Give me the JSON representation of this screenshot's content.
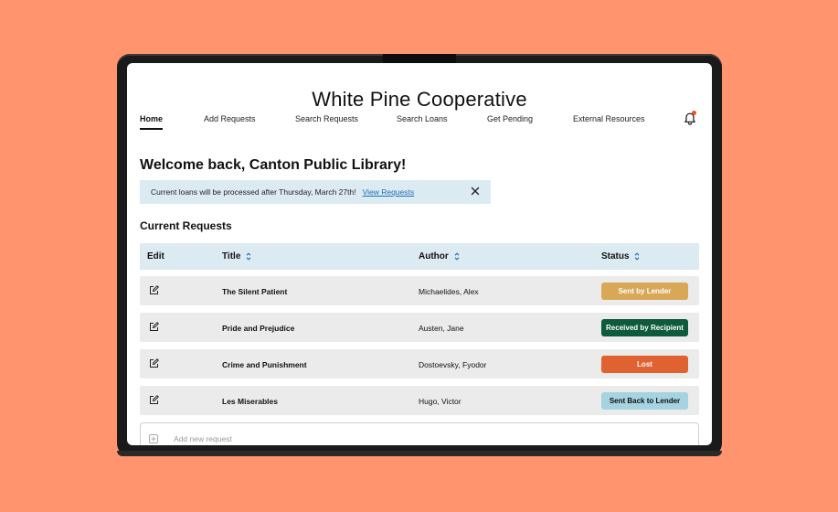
{
  "app": {
    "title": "White Pine Cooperative"
  },
  "nav": {
    "items": [
      {
        "label": "Home"
      },
      {
        "label": "Add Requests"
      },
      {
        "label": "Search Requests"
      },
      {
        "label": "Search Loans"
      },
      {
        "label": "Get Pending"
      },
      {
        "label": "External Resources"
      }
    ],
    "active": "Home"
  },
  "welcome": "Welcome back, Canton Public Library!",
  "banner": {
    "message": "Current loans will be processed after Thursday, March 27th!",
    "link": "View Requests"
  },
  "requests": {
    "heading": "Current Requests",
    "columns": {
      "edit": "Edit",
      "title": "Title",
      "author": "Author",
      "status": "Status"
    },
    "rows": [
      {
        "title": "The Silent Patient",
        "author": "Michaelides, Alex",
        "status": "Sent by Lender",
        "status_color": "#D9A857",
        "status_text_color": "#ffffff"
      },
      {
        "title": "Pride and Prejudice",
        "author": "Austen, Jane",
        "status": "Received by Recipient",
        "status_color": "#0E5A3C",
        "status_text_color": "#ffffff"
      },
      {
        "title": "Crime and Punishment",
        "author": "Dostoevsky, Fyodor",
        "status": "Lost",
        "status_color": "#E06230",
        "status_text_color": "#ffffff"
      },
      {
        "title": "Les Miserables",
        "author": "Hugo, Victor",
        "status": "Sent Back to Lender",
        "status_color": "#A5D3DF",
        "status_text_color": "#111111"
      }
    ],
    "add_label": "Add new request"
  },
  "colors": {
    "background": "#FF946E",
    "header_row": "#DCEBF2",
    "notification_dot": "#E8532D",
    "link": "#1E6FB8"
  }
}
